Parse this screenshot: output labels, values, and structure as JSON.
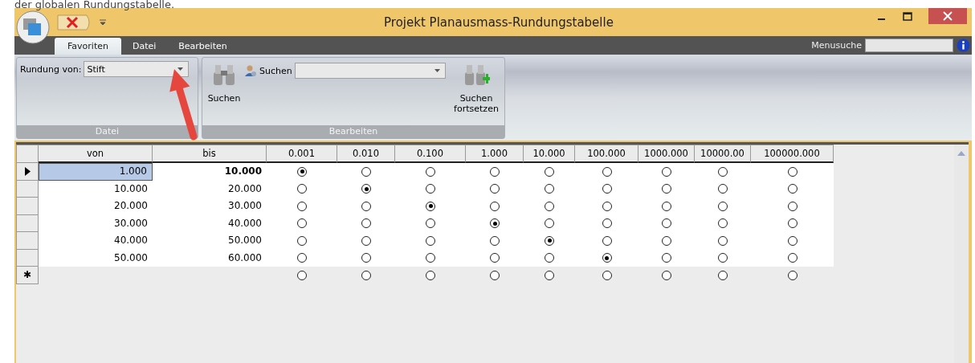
{
  "caption": "der globalen Rundungstabelle.",
  "window": {
    "title": "Projekt Planausmass-Rundungstabelle"
  },
  "tabs": [
    {
      "label": "Favoriten",
      "selected": true
    },
    {
      "label": "Datei",
      "selected": false
    },
    {
      "label": "Bearbeiten",
      "selected": false
    }
  ],
  "menu_search": {
    "label": "Menusuche"
  },
  "ribbon": {
    "groups": [
      {
        "title": "Datei",
        "kind": "rounding",
        "label": "Rundung von:",
        "value": "Stift"
      },
      {
        "title": "Bearbeiten",
        "kind": "search",
        "search_button": "Suchen",
        "search_label": "Suchen",
        "continue_button": "Suchen fortsetzen"
      }
    ]
  },
  "table": {
    "columns": [
      "von",
      "bis",
      "0.001",
      "0.010",
      "0.100",
      "1.000",
      "10.000",
      "100.000",
      "1000.000",
      "10000.00",
      "100000.000"
    ],
    "rows": [
      {
        "kind": "data",
        "current": true,
        "von": "1.000",
        "bis": "10.000",
        "options": [
          {
            "selected": true
          },
          {
            "selected": false
          },
          {
            "selected": false
          },
          {
            "selected": false
          },
          {
            "selected": false
          },
          {
            "selected": false
          },
          {
            "selected": false
          },
          {
            "selected": false
          },
          {
            "selected": false
          }
        ]
      },
      {
        "kind": "data",
        "current": false,
        "von": "10.000",
        "bis": "20.000",
        "options": [
          {
            "selected": false
          },
          {
            "selected": true
          },
          {
            "selected": false
          },
          {
            "selected": false
          },
          {
            "selected": false
          },
          {
            "selected": false
          },
          {
            "selected": false
          },
          {
            "selected": false
          },
          {
            "selected": false
          }
        ]
      },
      {
        "kind": "data",
        "current": false,
        "von": "20.000",
        "bis": "30.000",
        "options": [
          {
            "selected": false
          },
          {
            "selected": false
          },
          {
            "selected": true
          },
          {
            "selected": false
          },
          {
            "selected": false
          },
          {
            "selected": false
          },
          {
            "selected": false
          },
          {
            "selected": false
          },
          {
            "selected": false
          }
        ]
      },
      {
        "kind": "data",
        "current": false,
        "von": "30.000",
        "bis": "40.000",
        "options": [
          {
            "selected": false
          },
          {
            "selected": false
          },
          {
            "selected": false
          },
          {
            "selected": true
          },
          {
            "selected": false
          },
          {
            "selected": false
          },
          {
            "selected": false
          },
          {
            "selected": false
          },
          {
            "selected": false
          }
        ]
      },
      {
        "kind": "data",
        "current": false,
        "von": "40.000",
        "bis": "50.000",
        "options": [
          {
            "selected": false
          },
          {
            "selected": false
          },
          {
            "selected": false
          },
          {
            "selected": false
          },
          {
            "selected": true
          },
          {
            "selected": false
          },
          {
            "selected": false
          },
          {
            "selected": false
          },
          {
            "selected": false
          }
        ]
      },
      {
        "kind": "data",
        "current": false,
        "von": "50.000",
        "bis": "60.000",
        "options": [
          {
            "selected": false
          },
          {
            "selected": false
          },
          {
            "selected": false
          },
          {
            "selected": false
          },
          {
            "selected": false
          },
          {
            "selected": true
          },
          {
            "selected": false
          },
          {
            "selected": false
          },
          {
            "selected": false
          }
        ]
      },
      {
        "kind": "new",
        "marker": "✱",
        "options": [
          {
            "selected": false
          },
          {
            "selected": false
          },
          {
            "selected": false
          },
          {
            "selected": false
          },
          {
            "selected": false
          },
          {
            "selected": false
          },
          {
            "selected": false
          },
          {
            "selected": false
          },
          {
            "selected": false
          }
        ]
      }
    ]
  }
}
